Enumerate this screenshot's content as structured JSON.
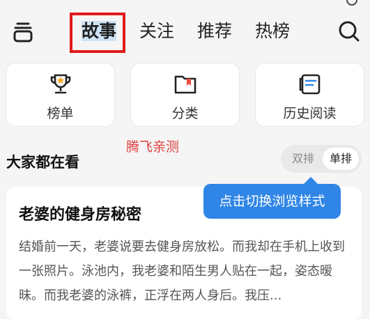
{
  "header": {
    "tabs": [
      {
        "label": "故事",
        "active": true
      },
      {
        "label": "关注"
      },
      {
        "label": "推荐"
      },
      {
        "label": "热榜"
      }
    ],
    "menu_icon": "stack-menu-icon",
    "search_icon": "search-icon"
  },
  "quick_entries": [
    {
      "label": "榜单",
      "icon": "trophy-icon"
    },
    {
      "label": "分类",
      "icon": "folder-bookmark-icon"
    },
    {
      "label": "历史阅读",
      "icon": "history-book-icon"
    }
  ],
  "watermark": "腾飞亲测",
  "section": {
    "title": "大家都在看",
    "toggle": {
      "option_left": "双排",
      "option_right": "单排",
      "selected": "单排"
    }
  },
  "tooltip": "点击切换浏览样式",
  "story": {
    "title": "老婆的健身房秘密",
    "excerpt": "结婚前一天，老婆说要去健身房放松。而我却在手机上收到一张照片。泳池内，我老婆和陌生男人贴在一起，姿态暧昧。而我老婆的泳裤，正浮在两人身后。我压..."
  },
  "colors": {
    "accent": "#2f86e6",
    "highlight_box": "#e11a1a",
    "watermark": "#e04040",
    "background": "#f5f5f5"
  }
}
